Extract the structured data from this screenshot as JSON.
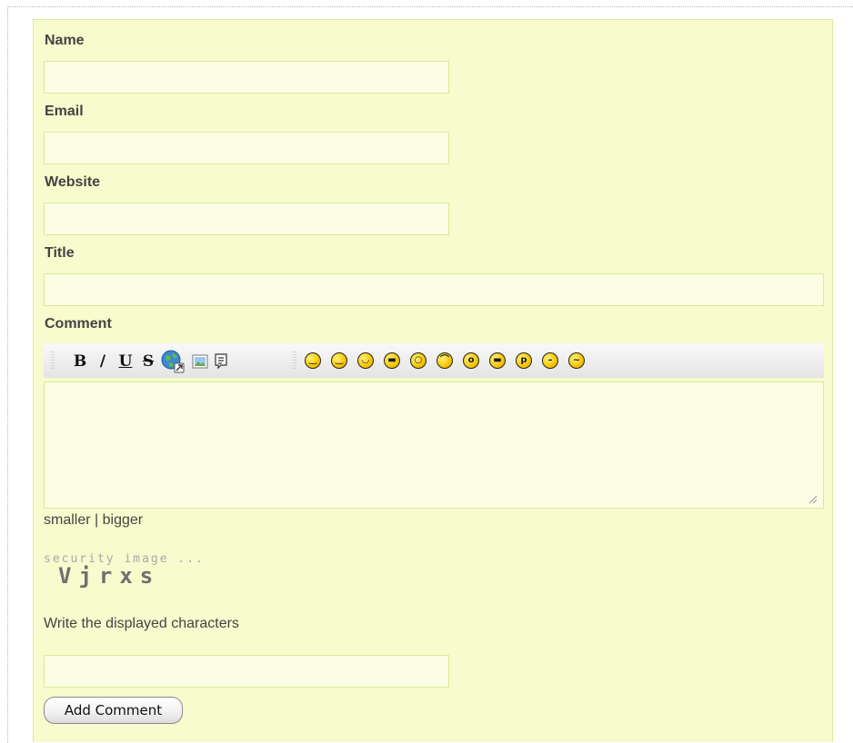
{
  "form": {
    "labels": {
      "name": "Name",
      "email": "Email",
      "website": "Website",
      "title": "Title",
      "comment": "Comment"
    },
    "inputs": {
      "name_value": "",
      "email_value": "",
      "website_value": "",
      "title_value": "",
      "comment_value": ""
    },
    "toolbar": {
      "bold_label": "B",
      "italic_label": "/",
      "underline_label": "U",
      "strike_label": "S",
      "icons": [
        "bold-icon",
        "italic-icon",
        "underline-icon",
        "strikethrough-icon",
        "link-globe-icon",
        "image-icon",
        "quote-icon"
      ],
      "smilies": [
        "smile-icon",
        "wink-icon",
        "happy-icon",
        "grin-icon",
        "angry-icon",
        "sad-icon",
        "surprised-icon",
        "cool-icon",
        "tongue-icon",
        "neutral-icon",
        "confused-icon"
      ]
    },
    "size_controls": {
      "smaller": "smaller",
      "separator": " | ",
      "bigger": "bigger"
    },
    "captcha": {
      "caption": "security image ...",
      "characters": "Vjrxs"
    },
    "captcha_instruction": "Write the displayed characters",
    "captcha_value": "",
    "submit_label": "Add Comment"
  },
  "colors": {
    "form_background": "#f7fbcd",
    "field_background": "#fbfde4",
    "field_border": "#d8eb9b",
    "label_text": "#444444"
  }
}
